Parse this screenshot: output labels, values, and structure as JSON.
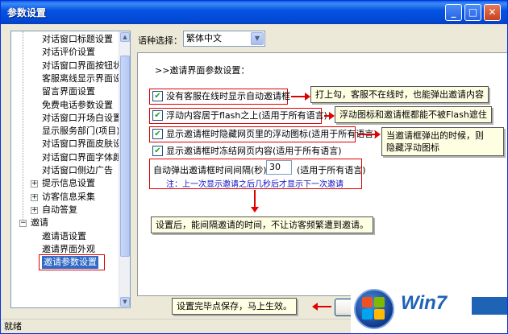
{
  "window": {
    "title": "参数设置",
    "buttons": {
      "minimize": "_",
      "maximize": "□",
      "close": "✕"
    }
  },
  "tree": {
    "items": [
      {
        "label": "对话窗口标题设置",
        "level": 2
      },
      {
        "label": "对话评价设置",
        "level": 2
      },
      {
        "label": "对话窗口界面按钮状态",
        "level": 2
      },
      {
        "label": "客服离线显示界面设置",
        "level": 2
      },
      {
        "label": "留言界面设置",
        "level": 2
      },
      {
        "label": "免费电话参数设置",
        "level": 2
      },
      {
        "label": "对话窗口开场白设置",
        "level": 2
      },
      {
        "label": "显示服务部门(项目)设",
        "level": 2
      },
      {
        "label": "对话窗口界面皮肤设置",
        "level": 2
      },
      {
        "label": "对话窗口界面字体颜色",
        "level": 2
      },
      {
        "label": "对话窗口侧边广告",
        "level": 2
      },
      {
        "label": "提示信息设置",
        "level": 1,
        "expander": "+"
      },
      {
        "label": "访客信息采集",
        "level": 1,
        "expander": "+"
      },
      {
        "label": "自动答复",
        "level": 1,
        "expander": "+"
      },
      {
        "label": "邀请",
        "level": 0,
        "expander": "−"
      },
      {
        "label": "邀请语设置",
        "level": 2
      },
      {
        "label": "邀请界面外观",
        "level": 2
      },
      {
        "label": "邀请参数设置",
        "level": 2,
        "selected": true
      }
    ]
  },
  "language": {
    "label": "语种选择：",
    "value": "繁体中文"
  },
  "section": {
    "title": ">>邀请界面参数设置："
  },
  "options": [
    {
      "label": "没有客服在线时显示自动邀请框",
      "checked": true
    },
    {
      "label": "浮动内容居于flash之上(适用于所有语言)",
      "checked": true
    },
    {
      "label": "显示邀请框时隐藏网页里的浮动图标(适用于所有语言)",
      "checked": true
    },
    {
      "label": "显示邀请框时冻结网页内容(适用于所有语言)",
      "checked": true
    }
  ],
  "interval": {
    "label": "自动弹出邀请框时间间隔(秒)：",
    "value": "30",
    "suffix": "(适用于所有语言)",
    "note": "注：上一次显示邀请之后几秒后才显示下一次邀请"
  },
  "callouts": {
    "c1": "打上勾，客服不在线时，也能弹出邀请内容",
    "c2": "浮动图标和邀请框都能不被Flash遮住",
    "c3_line1": "当邀请框弹出的时候，则",
    "c3_line2": "隐藏浮动图标",
    "c4": "设置后，能间隔邀请的时间，不让访客频繁遭到邀请。",
    "c5": "设置完毕点保存，马上生效。"
  },
  "logo": {
    "text": "Win7"
  },
  "status": {
    "text": "就绪"
  },
  "colors": {
    "annotation_red": "#E00000",
    "title_blue": "#0554E3",
    "note_blue": "#1010C0"
  }
}
